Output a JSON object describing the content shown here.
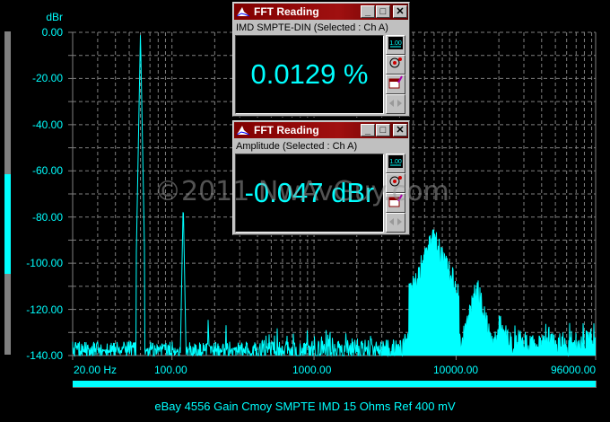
{
  "axis": {
    "y_unit": "dBr",
    "y_ticks": [
      "0.00",
      "-20.00",
      "-40.00",
      "-60.00",
      "-80.00",
      "-100.00",
      "-120.00",
      "-140.00"
    ],
    "x_ticks": [
      "20.00 Hz",
      "100.00",
      "1000.00",
      "10000.00",
      "96000.00"
    ]
  },
  "caption": "eBay 4556 Gain Cmoy SMPTE IMD 15 Ohms Ref 400 mV",
  "watermark": "©2011 NwAvGuy.com",
  "level_meter": {
    "low_db": -105,
    "high_db": -62
  },
  "windows": [
    {
      "title": "FFT Reading",
      "subtitle": "IMD SMPTE-DIN (Selected : Ch A)",
      "value": "0.0129 %"
    },
    {
      "title": "FFT Reading",
      "subtitle": "Amplitude (Selected : Ch A)",
      "value": "-0.047 dBr"
    }
  ],
  "window_buttons": {
    "minimize": "_",
    "maximize": "□",
    "close": "✕"
  },
  "tool_icons": [
    "numeric-display-icon",
    "channel-select-icon",
    "data-table-icon",
    "arrows-icon"
  ],
  "colors": {
    "trace": "#00ffff",
    "grid": "#808080",
    "titlebar": "#800000"
  },
  "chart_data": {
    "type": "line",
    "title": "eBay 4556 Gain Cmoy SMPTE IMD 15 Ohms Ref 400 mV",
    "xlabel": "Hz",
    "ylabel": "dBr",
    "xscale": "log",
    "xlim": [
      20,
      96000
    ],
    "ylim": [
      -140,
      0
    ],
    "grid": true,
    "noise_floor_db": [
      -134,
      -130
    ],
    "peaks": [
      {
        "freq": 60,
        "db": 0
      },
      {
        "freq": 120,
        "db": -73
      },
      {
        "freq": 180,
        "db": -122
      },
      {
        "freq": 240,
        "db": -125
      },
      {
        "freq": 7000,
        "db": -84
      },
      {
        "freq": 14000,
        "db": -105
      },
      {
        "freq": 21000,
        "db": -118
      },
      {
        "freq": 28000,
        "db": -127
      },
      {
        "freq": 35000,
        "db": -132
      },
      {
        "freq": 42000,
        "db": -131
      }
    ]
  }
}
